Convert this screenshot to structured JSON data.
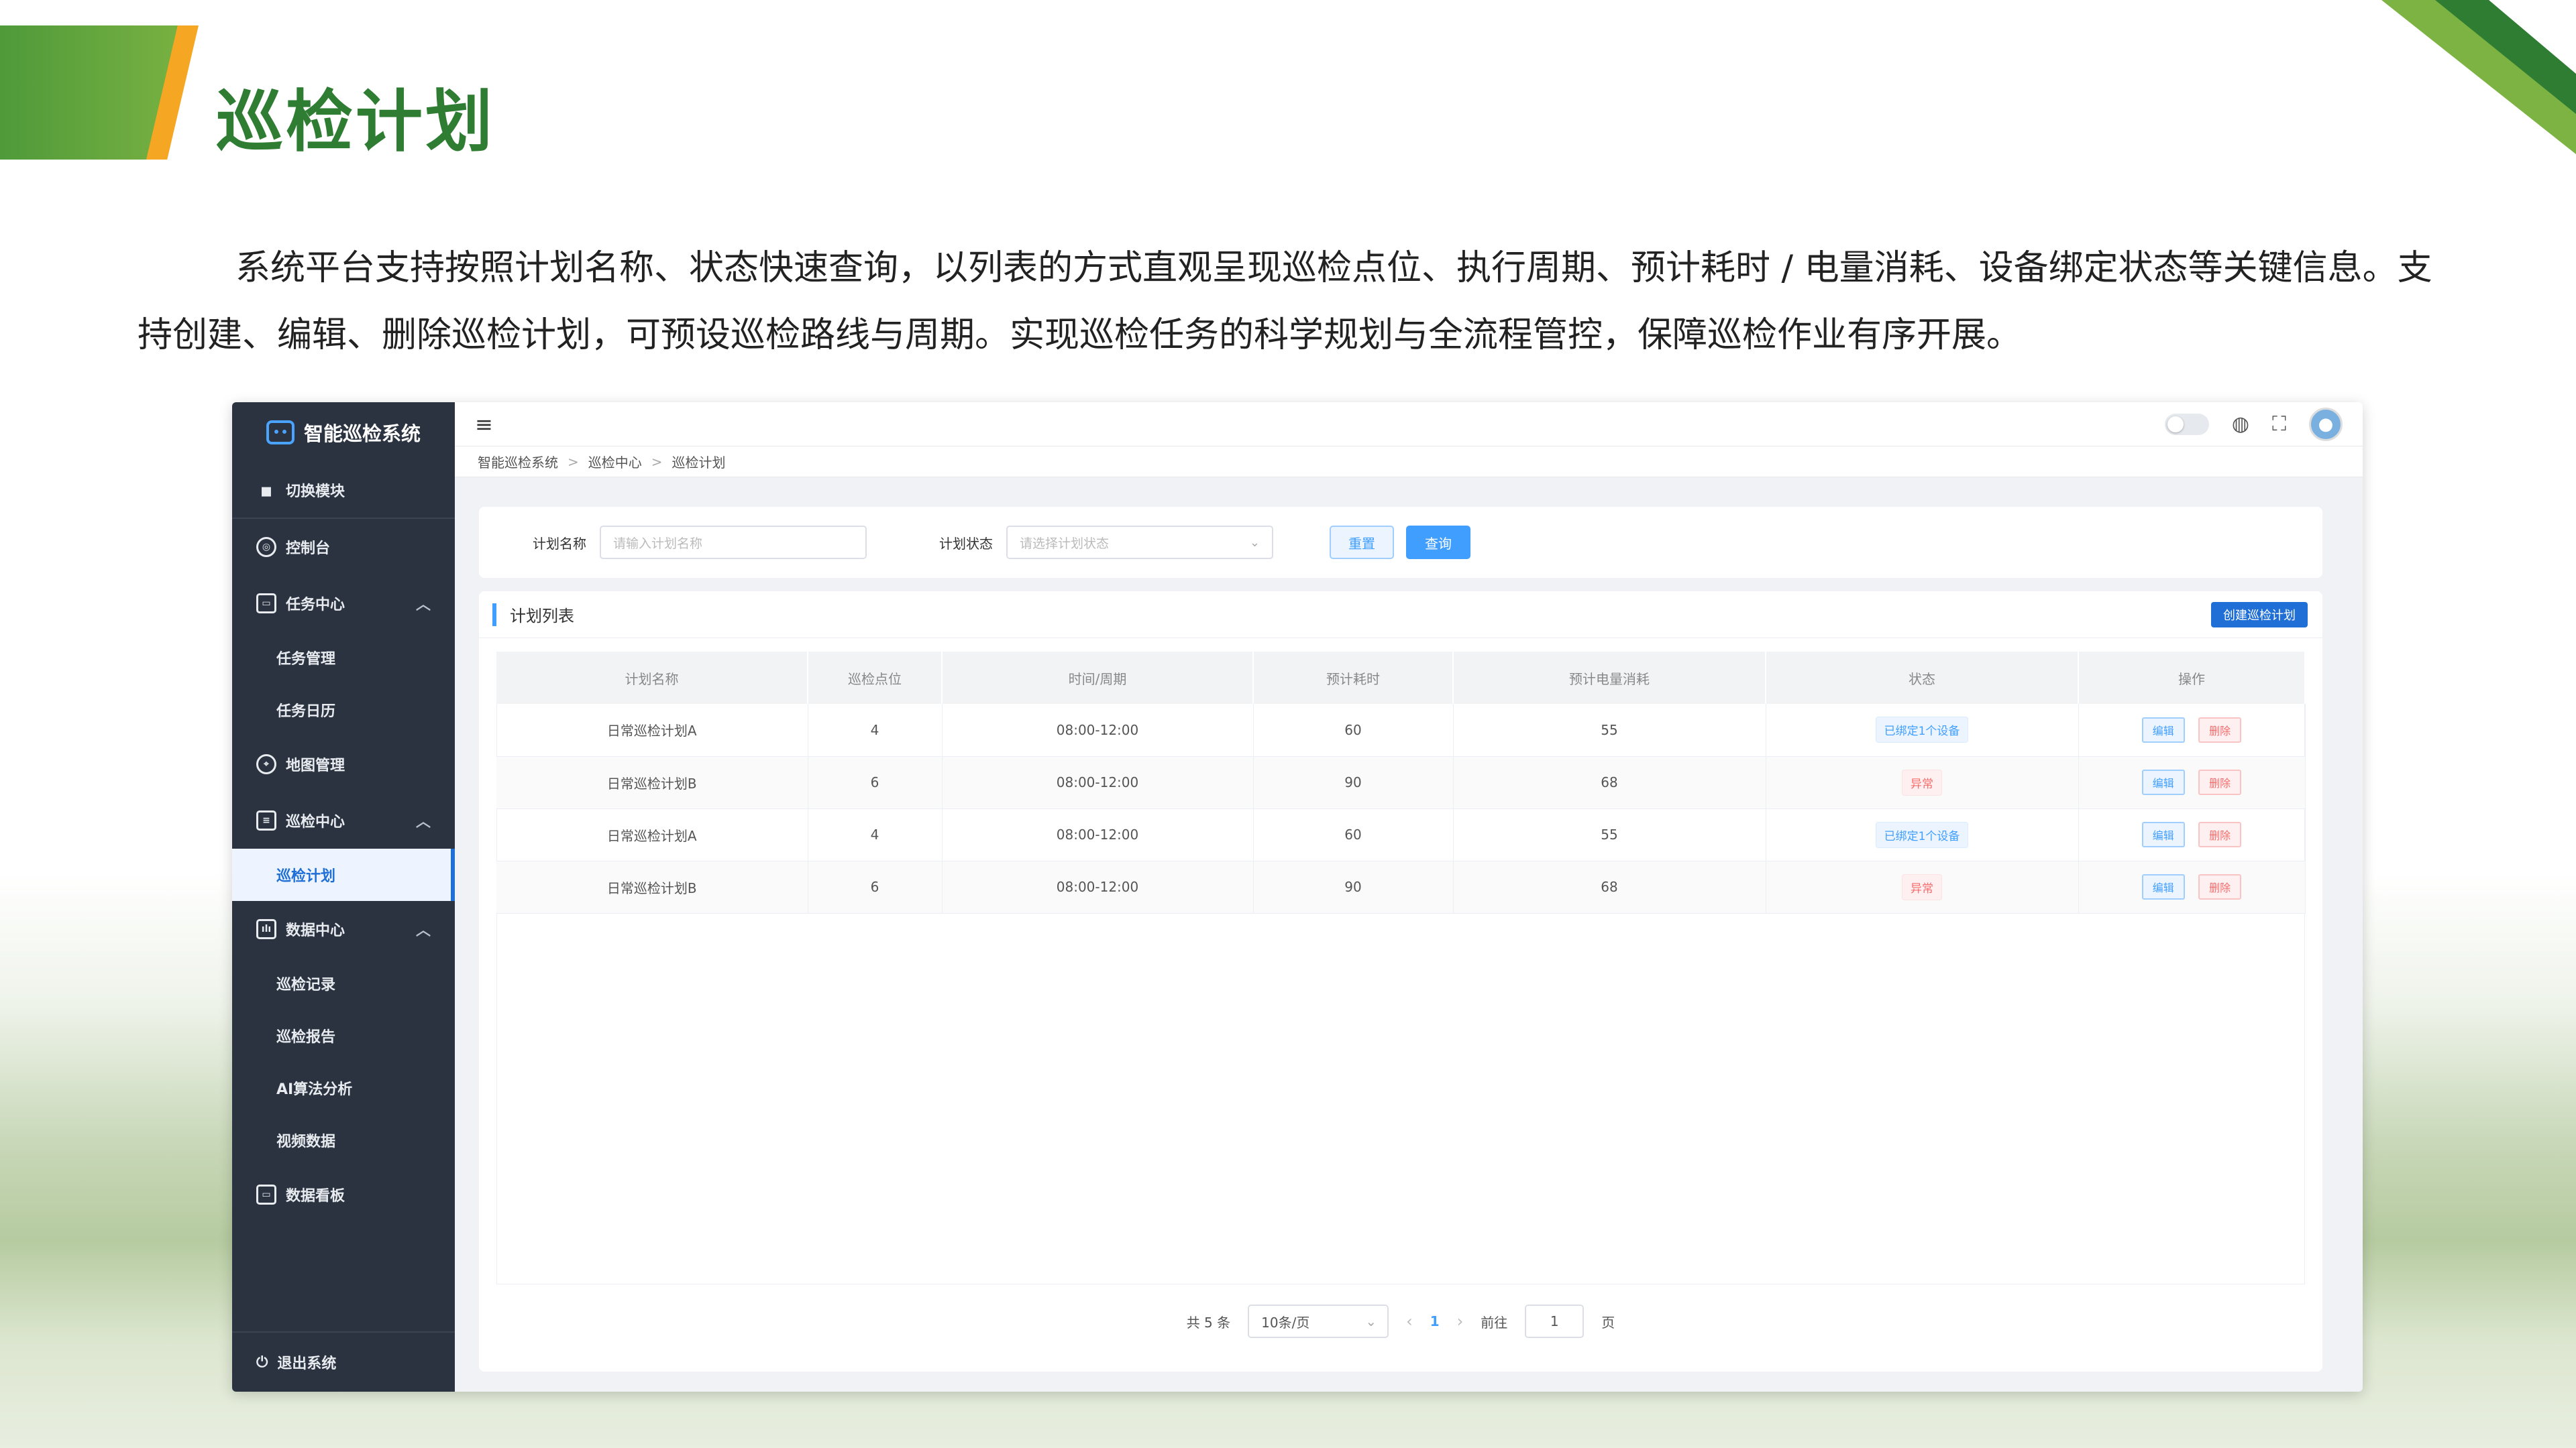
{
  "slide": {
    "title": "巡检计划",
    "intro": "系统平台支持按照计划名称、状态快速查询，以列表的方式直观呈现巡检点位、执行周期、预计耗时 / 电量消耗、设备绑定状态等关键信息。支持创建、编辑、删除巡检计划，可预设巡检路线与周期。实现巡检任务的科学规划与全流程管控，保障巡检作业有序开展。"
  },
  "sidebar": {
    "app_name": "智能巡检系统",
    "switch_module": "切换模块",
    "console": "控制台",
    "task_center": "任务中心",
    "task_mgmt": "任务管理",
    "task_calendar": "任务日历",
    "map_mgmt": "地图管理",
    "patrol_center": "巡检中心",
    "patrol_plan": "巡检计划",
    "data_center": "数据中心",
    "patrol_record": "巡检记录",
    "patrol_report": "巡检报告",
    "ai_analysis": "AI算法分析",
    "video_data": "视频数据",
    "dashboard": "数据看板",
    "logout": "退出系统"
  },
  "breadcrumb": [
    "智能巡检系统",
    "巡检中心",
    "巡检计划"
  ],
  "search": {
    "name_label": "计划名称",
    "name_placeholder": "请输入计划名称",
    "status_label": "计划状态",
    "status_placeholder": "请选择计划状态",
    "reset": "重置",
    "query": "查询"
  },
  "list": {
    "title": "计划列表",
    "create": "创建巡检计划",
    "columns": [
      "计划名称",
      "巡检点位",
      "时间/周期",
      "预计耗时",
      "预计电量消耗",
      "状态",
      "操作"
    ],
    "rows": [
      {
        "name": "日常巡检计划A",
        "points": "4",
        "period": "08:00-12:00",
        "time": "60",
        "power": "55",
        "status": "已绑定1个设备",
        "status_type": "bound"
      },
      {
        "name": "日常巡检计划B",
        "points": "6",
        "period": "08:00-12:00",
        "time": "90",
        "power": "68",
        "status": "异常",
        "status_type": "abnormal"
      },
      {
        "name": "日常巡检计划A",
        "points": "4",
        "period": "08:00-12:00",
        "time": "60",
        "power": "55",
        "status": "已绑定1个设备",
        "status_type": "bound"
      },
      {
        "name": "日常巡检计划B",
        "points": "6",
        "period": "08:00-12:00",
        "time": "90",
        "power": "68",
        "status": "异常",
        "status_type": "abnormal"
      }
    ],
    "edit": "编辑",
    "delete": "删除"
  },
  "pager": {
    "total": "共 5 条",
    "page_size": "10条/页",
    "current": "1",
    "goto": "前往",
    "goto_value": "1",
    "page_unit": "页"
  },
  "colors": {
    "brand_green": "#2e7d32",
    "accent_orange": "#f5a623",
    "primary_blue": "#409eff",
    "sidebar_bg": "#2b3340"
  }
}
